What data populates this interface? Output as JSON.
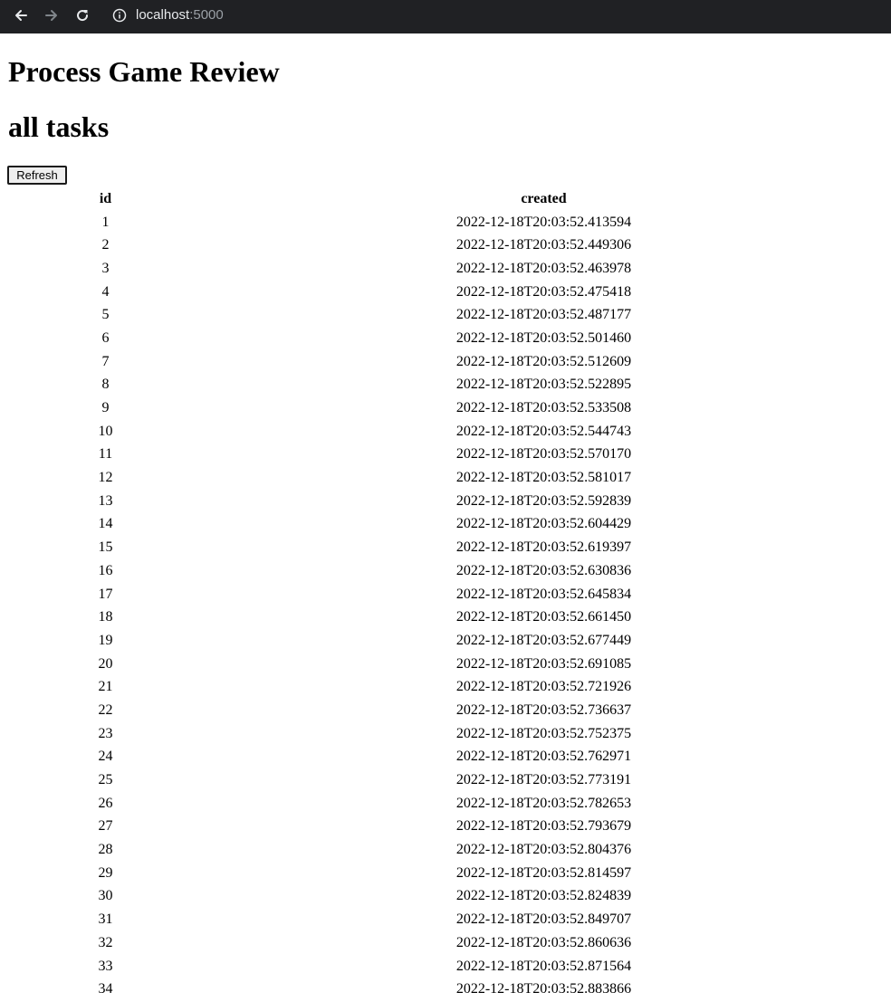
{
  "browser": {
    "url_host": "localhost",
    "url_port": ":5000"
  },
  "page": {
    "title": "Process Game Review",
    "subtitle": "all tasks",
    "refresh_label": "Refresh"
  },
  "table": {
    "headers": [
      "id",
      "created"
    ],
    "rows": [
      [
        "1",
        "2022-12-18T20:03:52.413594"
      ],
      [
        "2",
        "2022-12-18T20:03:52.449306"
      ],
      [
        "3",
        "2022-12-18T20:03:52.463978"
      ],
      [
        "4",
        "2022-12-18T20:03:52.475418"
      ],
      [
        "5",
        "2022-12-18T20:03:52.487177"
      ],
      [
        "6",
        "2022-12-18T20:03:52.501460"
      ],
      [
        "7",
        "2022-12-18T20:03:52.512609"
      ],
      [
        "8",
        "2022-12-18T20:03:52.522895"
      ],
      [
        "9",
        "2022-12-18T20:03:52.533508"
      ],
      [
        "10",
        "2022-12-18T20:03:52.544743"
      ],
      [
        "11",
        "2022-12-18T20:03:52.570170"
      ],
      [
        "12",
        "2022-12-18T20:03:52.581017"
      ],
      [
        "13",
        "2022-12-18T20:03:52.592839"
      ],
      [
        "14",
        "2022-12-18T20:03:52.604429"
      ],
      [
        "15",
        "2022-12-18T20:03:52.619397"
      ],
      [
        "16",
        "2022-12-18T20:03:52.630836"
      ],
      [
        "17",
        "2022-12-18T20:03:52.645834"
      ],
      [
        "18",
        "2022-12-18T20:03:52.661450"
      ],
      [
        "19",
        "2022-12-18T20:03:52.677449"
      ],
      [
        "20",
        "2022-12-18T20:03:52.691085"
      ],
      [
        "21",
        "2022-12-18T20:03:52.721926"
      ],
      [
        "22",
        "2022-12-18T20:03:52.736637"
      ],
      [
        "23",
        "2022-12-18T20:03:52.752375"
      ],
      [
        "24",
        "2022-12-18T20:03:52.762971"
      ],
      [
        "25",
        "2022-12-18T20:03:52.773191"
      ],
      [
        "26",
        "2022-12-18T20:03:52.782653"
      ],
      [
        "27",
        "2022-12-18T20:03:52.793679"
      ],
      [
        "28",
        "2022-12-18T20:03:52.804376"
      ],
      [
        "29",
        "2022-12-18T20:03:52.814597"
      ],
      [
        "30",
        "2022-12-18T20:03:52.824839"
      ],
      [
        "31",
        "2022-12-18T20:03:52.849707"
      ],
      [
        "32",
        "2022-12-18T20:03:52.860636"
      ],
      [
        "33",
        "2022-12-18T20:03:52.871564"
      ],
      [
        "34",
        "2022-12-18T20:03:52.883866"
      ]
    ]
  }
}
